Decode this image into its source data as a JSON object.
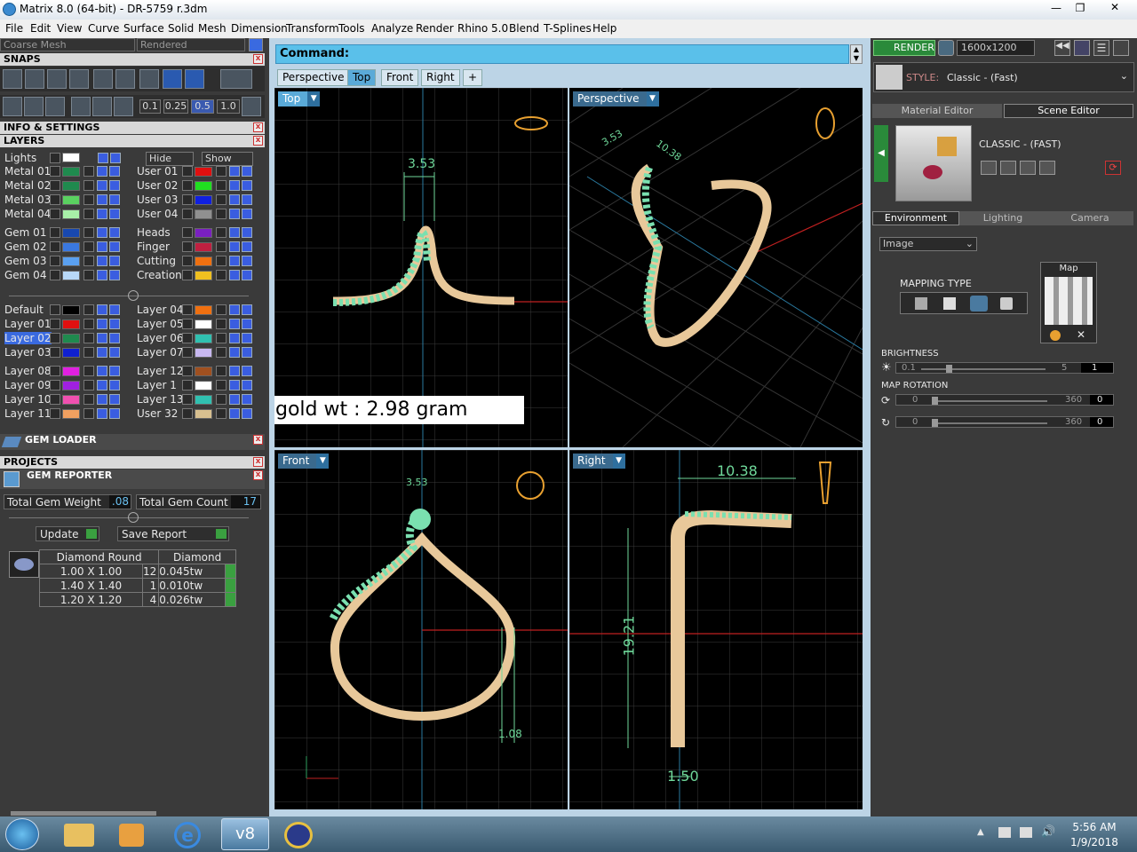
{
  "window": {
    "title": "Matrix 8.0 (64-bit) - DR-5759 r.3dm"
  },
  "menu": [
    "File",
    "Edit",
    "View",
    "Curve",
    "Surface",
    "Solid",
    "Mesh",
    "Dimension",
    "Transform",
    "Tools",
    "Analyze",
    "Render",
    "Rhino 5.0",
    "Blend",
    "T-Splines",
    "Help"
  ],
  "left": {
    "mesh_mode": "Coarse Mesh",
    "display_mode": "Rendered",
    "snaps_title": "SNAPS",
    "grid_values": [
      "0.1",
      "0.25",
      "0.5",
      "1.0"
    ],
    "info_title": "INFO & SETTINGS",
    "layers_title": "LAYERS",
    "hide_label": "Hide",
    "show_label": "Show",
    "lights_label": "Lights",
    "layers_left": [
      "Metal 01",
      "Metal 02",
      "Metal 03",
      "Metal 04",
      "Gem 01",
      "Gem 02",
      "Gem 03",
      "Gem 04",
      "Default",
      "Layer 01",
      "Layer 02",
      "Layer 03",
      "Layer 08",
      "Layer 09",
      "Layer 10",
      "Layer 11"
    ],
    "layers_right": [
      "User 01",
      "User 02",
      "User 03",
      "User 04",
      "Heads",
      "Finger",
      "Cutting",
      "Creation",
      "Layer 04",
      "Layer 05",
      "Layer 06",
      "Layer 07",
      "Layer 12",
      "Layer 1",
      "Layer 13",
      "User 32"
    ],
    "colors_left": [
      "#1f8a4e",
      "#1f8a4e",
      "#5ad060",
      "#a8f0a8",
      "#1848b0",
      "#3a78e0",
      "#5aa0f0",
      "#b8d8f8",
      "#000000",
      "#e01010",
      "#1f8a4e",
      "#1020d0",
      "#e020e0",
      "#a020e0",
      "#f050b0",
      "#f0a060"
    ],
    "colors_right": [
      "#e01010",
      "#20e020",
      "#1020e0",
      "#909090",
      "#7a20c0",
      "#c02040",
      "#f07010",
      "#f0c020",
      "#f07010",
      "#ffffff",
      "#30c0b0",
      "#c8b8f0",
      "#a05020",
      "#ffffff",
      "#30c0b0",
      "#d8c090"
    ],
    "gem_loader": "GEM LOADER",
    "projects": "PROJECTS",
    "gem_reporter": "GEM REPORTER",
    "total_weight_label": "Total Gem Weight",
    "total_weight": ".08",
    "total_count_label": "Total Gem Count",
    "total_count": "17",
    "update_label": "Update",
    "save_report_label": "Save Report",
    "gem_table": {
      "headers": [
        "Diamond Round",
        "Diamond"
      ],
      "rows": [
        [
          "1.00 X 1.00",
          "12",
          "0.045tw"
        ],
        [
          "1.40 X 1.40",
          "1",
          "0.010tw"
        ],
        [
          "1.20 X 1.20",
          "4",
          "0.026tw"
        ]
      ]
    }
  },
  "command": {
    "label": "Command:"
  },
  "tabs": [
    "Perspective",
    "Top",
    "Front",
    "Right",
    "+"
  ],
  "viewports": {
    "top": {
      "label": "Top",
      "dim": "3.53",
      "note": "gold wt : 2.98 gram"
    },
    "perspective": {
      "label": "Perspective",
      "dim_a": "3.53",
      "dim_b": "10.38"
    },
    "front": {
      "label": "Front",
      "dim_a": "3.53",
      "dim_b": "1.08"
    },
    "right": {
      "label": "Right",
      "dim_a": "10.38",
      "dim_b": "19.21",
      "dim_c": "1.50"
    }
  },
  "right": {
    "render_label": "RENDER",
    "resolution": "1600x1200",
    "style_prefix": "STYLE:",
    "style_value": "Classic - (Fast)",
    "tabs_top": [
      "Material Editor",
      "Scene Editor"
    ],
    "scene_name": "CLASSIC - (FAST)",
    "tabs_env": [
      "Environment",
      "Lighting",
      "Camera"
    ],
    "env_type": "Image",
    "mapping_title": "MAPPING TYPE",
    "map_label": "Map",
    "brightness_title": "BRIGHTNESS",
    "brightness_min": "0.1",
    "brightness_max": "5",
    "brightness_val": "1",
    "rotation_title": "MAP ROTATION",
    "rot1_min": "0",
    "rot1_max": "360",
    "rot1_val": "0",
    "rot2_min": "0",
    "rot2_max": "360",
    "rot2_val": "0"
  },
  "taskbar": {
    "time": "5:56 AM",
    "date": "1/9/2018"
  },
  "accent": {
    "viewport_label": "#5aaad8",
    "dimension": "#6fd89a",
    "gold": "#e8c89a",
    "gem": "#7ae0b0"
  }
}
